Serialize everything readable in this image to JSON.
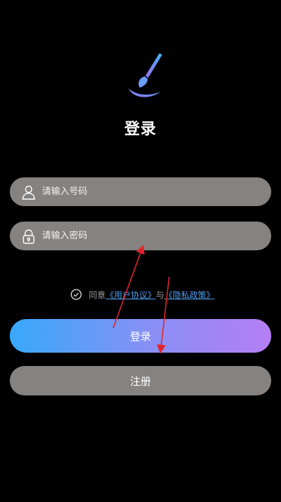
{
  "page": {
    "title": "登录"
  },
  "username_field": {
    "placeholder": "请输入号码",
    "value": ""
  },
  "password_field": {
    "placeholder": "请输入密码",
    "value": ""
  },
  "agreement": {
    "prefix": "同意",
    "user_agreement": "《用户协议》",
    "joiner": "与",
    "privacy_policy": "《隐私政策》",
    "checked": true
  },
  "buttons": {
    "login": "登录",
    "register": "注册"
  },
  "colors": {
    "background": "#000000",
    "field": "#858280",
    "link": "#4f9df0",
    "login_gradient_start": "#37a9fb",
    "login_gradient_end": "#b57ef5",
    "annotation_arrow": "#e0242b"
  },
  "icons": {
    "logo": "paintbrush-logo-icon",
    "username": "user-icon",
    "password": "lock-icon",
    "agreement": "check-circle-icon"
  }
}
